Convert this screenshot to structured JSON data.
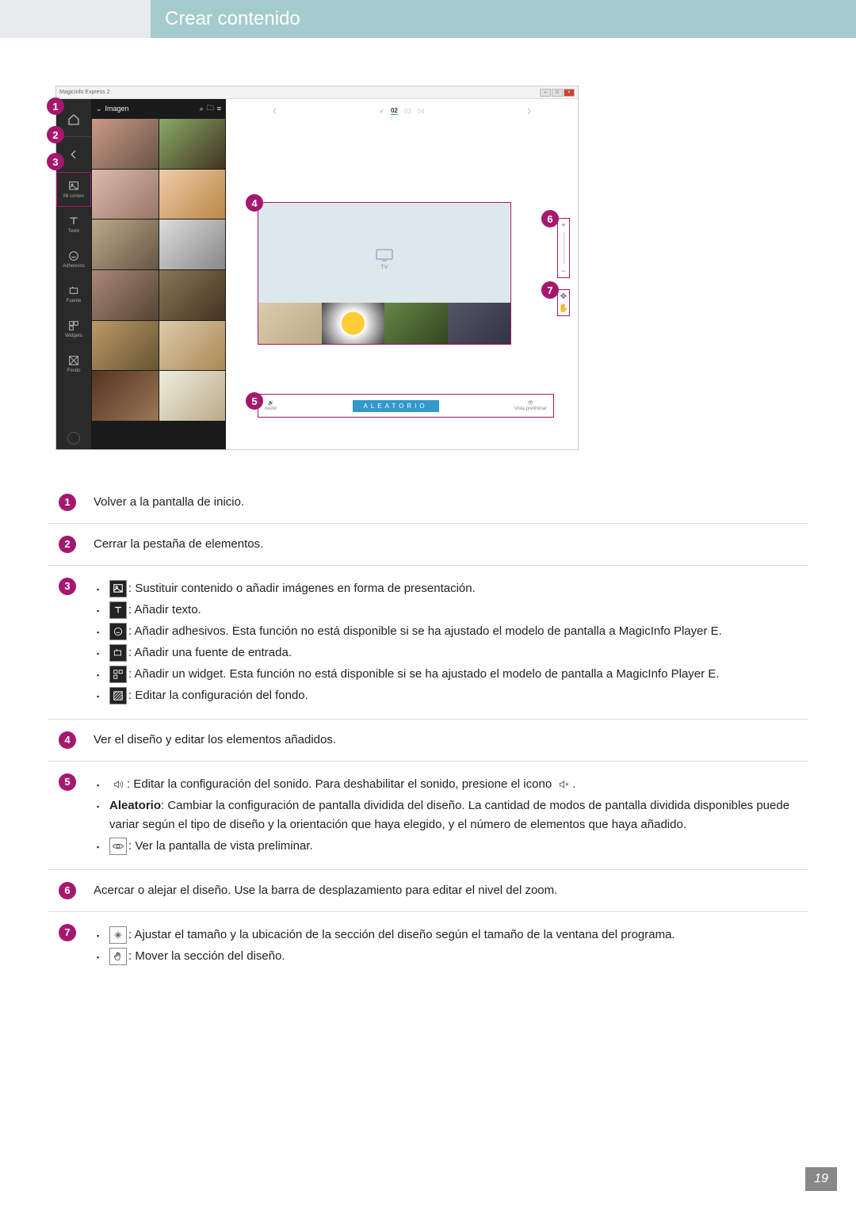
{
  "header": {
    "title": "Crear contenido"
  },
  "pageNumber": "19",
  "app": {
    "windowTitle": "MagicInfo Express 2",
    "mediaPanelTitle": "Imagen",
    "rail": {
      "miContent": "Mi conten",
      "texto": "Texto",
      "adhesivos": "Adhesivos",
      "fuente": "Fuente",
      "widgets": "Widgets",
      "fondo": "Fondo"
    },
    "steps": {
      "s2": "02",
      "s3": "03",
      "s4": "04"
    },
    "tvLabel": "TV",
    "bottomBar": {
      "audio": "Audio",
      "aleatorio": "ALEATORIO",
      "preview": "Vista preliminar"
    }
  },
  "markers": {
    "m1": "1",
    "m2": "2",
    "m3": "3",
    "m4": "4",
    "m5": "5",
    "m6": "6",
    "m7": "7"
  },
  "legend": {
    "r1": "Volver a la pantalla de inicio.",
    "r2": "Cerrar la pestaña de elementos.",
    "r3": {
      "a": ": Sustituir contenido o añadir imágenes en forma de presentación.",
      "b": ": Añadir texto.",
      "c": ": Añadir adhesivos. Esta función no está disponible si se ha ajustado el modelo de pantalla a MagicInfo Player E.",
      "d": ": Añadir una fuente de entrada.",
      "e": ": Añadir un widget. Esta función no está disponible si se ha ajustado el modelo de pantalla a MagicInfo Player E.",
      "f": ": Editar la configuración del fondo."
    },
    "r4": "Ver el diseño y editar los elementos añadidos.",
    "r5": {
      "a": ": Editar la configuración del sonido. Para deshabilitar el sonido, presione el icono ",
      "a2": ".",
      "bLabel": "Aleatorio",
      "b": ": Cambiar la configuración de pantalla dividida del diseño. La cantidad de modos de pantalla dividida disponibles puede variar según el tipo de diseño y la orientación que haya elegido, y el número de elementos que haya añadido.",
      "c": ": Ver la pantalla de vista preliminar."
    },
    "r6": "Acercar o alejar el diseño. Use la barra de desplazamiento para editar el nivel del zoom.",
    "r7": {
      "a": ": Ajustar el tamaño y la ubicación de la sección del diseño según el tamaño de la ventana del programa.",
      "b": ": Mover la sección del diseño."
    }
  }
}
